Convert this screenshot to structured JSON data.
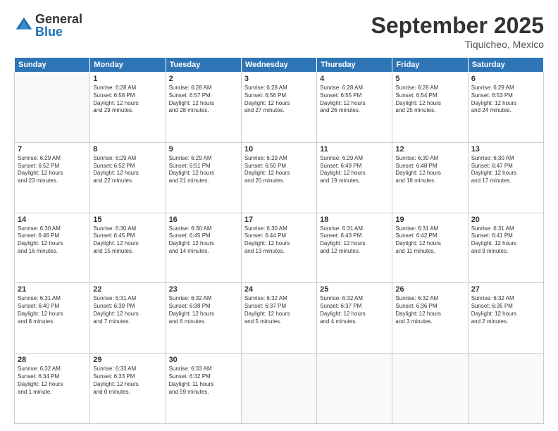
{
  "logo": {
    "general": "General",
    "blue": "Blue"
  },
  "header": {
    "month": "September 2025",
    "location": "Tiquicheo, Mexico"
  },
  "days_of_week": [
    "Sunday",
    "Monday",
    "Tuesday",
    "Wednesday",
    "Thursday",
    "Friday",
    "Saturday"
  ],
  "weeks": [
    [
      {
        "day": "",
        "info": ""
      },
      {
        "day": "1",
        "info": "Sunrise: 6:28 AM\nSunset: 6:58 PM\nDaylight: 12 hours\nand 29 minutes."
      },
      {
        "day": "2",
        "info": "Sunrise: 6:28 AM\nSunset: 6:57 PM\nDaylight: 12 hours\nand 28 minutes."
      },
      {
        "day": "3",
        "info": "Sunrise: 6:28 AM\nSunset: 6:56 PM\nDaylight: 12 hours\nand 27 minutes."
      },
      {
        "day": "4",
        "info": "Sunrise: 6:28 AM\nSunset: 6:55 PM\nDaylight: 12 hours\nand 26 minutes."
      },
      {
        "day": "5",
        "info": "Sunrise: 6:28 AM\nSunset: 6:54 PM\nDaylight: 12 hours\nand 25 minutes."
      },
      {
        "day": "6",
        "info": "Sunrise: 6:29 AM\nSunset: 6:53 PM\nDaylight: 12 hours\nand 24 minutes."
      }
    ],
    [
      {
        "day": "7",
        "info": "Sunrise: 6:29 AM\nSunset: 6:52 PM\nDaylight: 12 hours\nand 23 minutes."
      },
      {
        "day": "8",
        "info": "Sunrise: 6:29 AM\nSunset: 6:52 PM\nDaylight: 12 hours\nand 22 minutes."
      },
      {
        "day": "9",
        "info": "Sunrise: 6:29 AM\nSunset: 6:51 PM\nDaylight: 12 hours\nand 21 minutes."
      },
      {
        "day": "10",
        "info": "Sunrise: 6:29 AM\nSunset: 6:50 PM\nDaylight: 12 hours\nand 20 minutes."
      },
      {
        "day": "11",
        "info": "Sunrise: 6:29 AM\nSunset: 6:49 PM\nDaylight: 12 hours\nand 19 minutes."
      },
      {
        "day": "12",
        "info": "Sunrise: 6:30 AM\nSunset: 6:48 PM\nDaylight: 12 hours\nand 18 minutes."
      },
      {
        "day": "13",
        "info": "Sunrise: 6:30 AM\nSunset: 6:47 PM\nDaylight: 12 hours\nand 17 minutes."
      }
    ],
    [
      {
        "day": "14",
        "info": "Sunrise: 6:30 AM\nSunset: 6:46 PM\nDaylight: 12 hours\nand 16 minutes."
      },
      {
        "day": "15",
        "info": "Sunrise: 6:30 AM\nSunset: 6:45 PM\nDaylight: 12 hours\nand 15 minutes."
      },
      {
        "day": "16",
        "info": "Sunrise: 6:30 AM\nSunset: 6:45 PM\nDaylight: 12 hours\nand 14 minutes."
      },
      {
        "day": "17",
        "info": "Sunrise: 6:30 AM\nSunset: 6:44 PM\nDaylight: 12 hours\nand 13 minutes."
      },
      {
        "day": "18",
        "info": "Sunrise: 6:31 AM\nSunset: 6:43 PM\nDaylight: 12 hours\nand 12 minutes."
      },
      {
        "day": "19",
        "info": "Sunrise: 6:31 AM\nSunset: 6:42 PM\nDaylight: 12 hours\nand 11 minutes."
      },
      {
        "day": "20",
        "info": "Sunrise: 6:31 AM\nSunset: 6:41 PM\nDaylight: 12 hours\nand 9 minutes."
      }
    ],
    [
      {
        "day": "21",
        "info": "Sunrise: 6:31 AM\nSunset: 6:40 PM\nDaylight: 12 hours\nand 8 minutes."
      },
      {
        "day": "22",
        "info": "Sunrise: 6:31 AM\nSunset: 6:39 PM\nDaylight: 12 hours\nand 7 minutes."
      },
      {
        "day": "23",
        "info": "Sunrise: 6:32 AM\nSunset: 6:38 PM\nDaylight: 12 hours\nand 6 minutes."
      },
      {
        "day": "24",
        "info": "Sunrise: 6:32 AM\nSunset: 6:37 PM\nDaylight: 12 hours\nand 5 minutes."
      },
      {
        "day": "25",
        "info": "Sunrise: 6:32 AM\nSunset: 6:37 PM\nDaylight: 12 hours\nand 4 minutes."
      },
      {
        "day": "26",
        "info": "Sunrise: 6:32 AM\nSunset: 6:36 PM\nDaylight: 12 hours\nand 3 minutes."
      },
      {
        "day": "27",
        "info": "Sunrise: 6:32 AM\nSunset: 6:35 PM\nDaylight: 12 hours\nand 2 minutes."
      }
    ],
    [
      {
        "day": "28",
        "info": "Sunrise: 6:32 AM\nSunset: 6:34 PM\nDaylight: 12 hours\nand 1 minute."
      },
      {
        "day": "29",
        "info": "Sunrise: 6:33 AM\nSunset: 6:33 PM\nDaylight: 12 hours\nand 0 minutes."
      },
      {
        "day": "30",
        "info": "Sunrise: 6:33 AM\nSunset: 6:32 PM\nDaylight: 11 hours\nand 59 minutes."
      },
      {
        "day": "",
        "info": ""
      },
      {
        "day": "",
        "info": ""
      },
      {
        "day": "",
        "info": ""
      },
      {
        "day": "",
        "info": ""
      }
    ]
  ]
}
